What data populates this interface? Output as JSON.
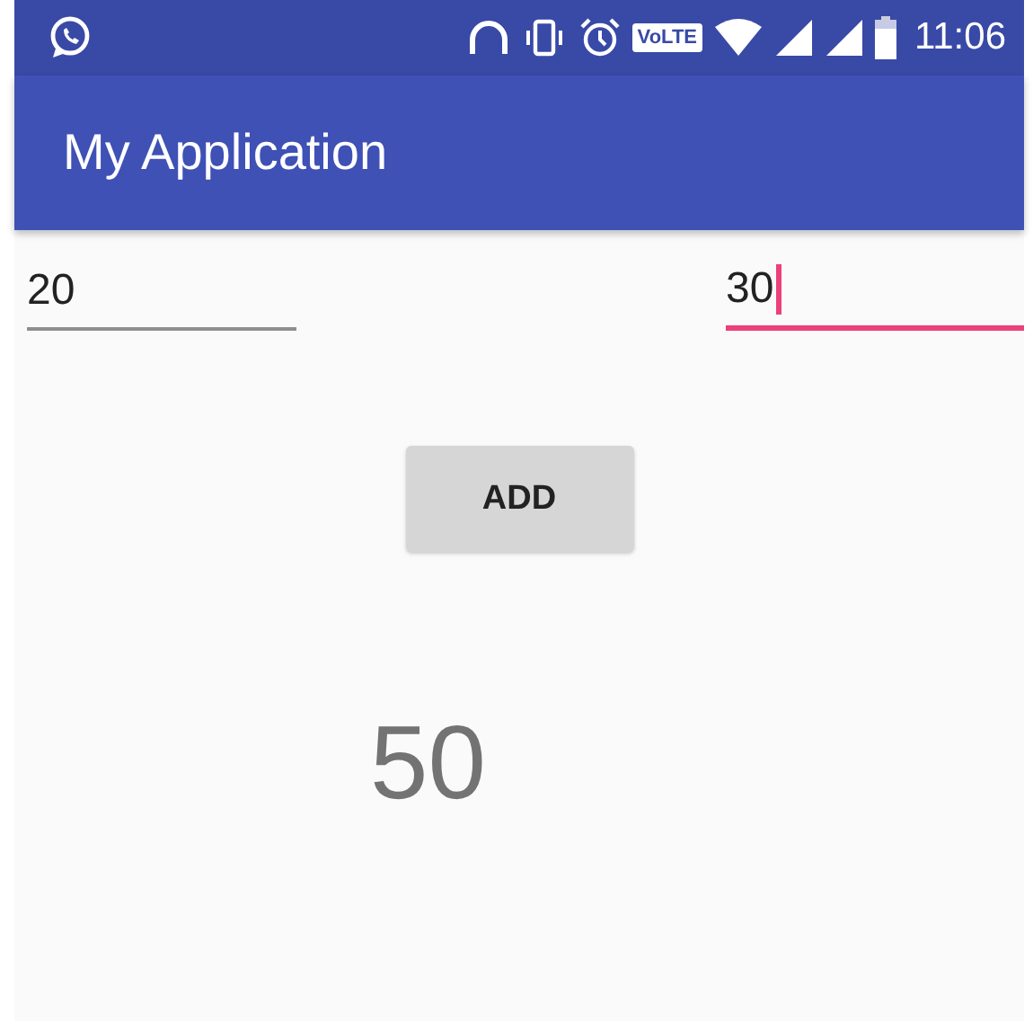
{
  "status_bar": {
    "volte": "VoLTE",
    "time": "11:06"
  },
  "app_bar": {
    "title": "My Application"
  },
  "fields": [
    {
      "value": "20",
      "focused": false
    },
    {
      "value": "30",
      "focused": true
    }
  ],
  "button": {
    "label": "ADD"
  },
  "result": "50"
}
